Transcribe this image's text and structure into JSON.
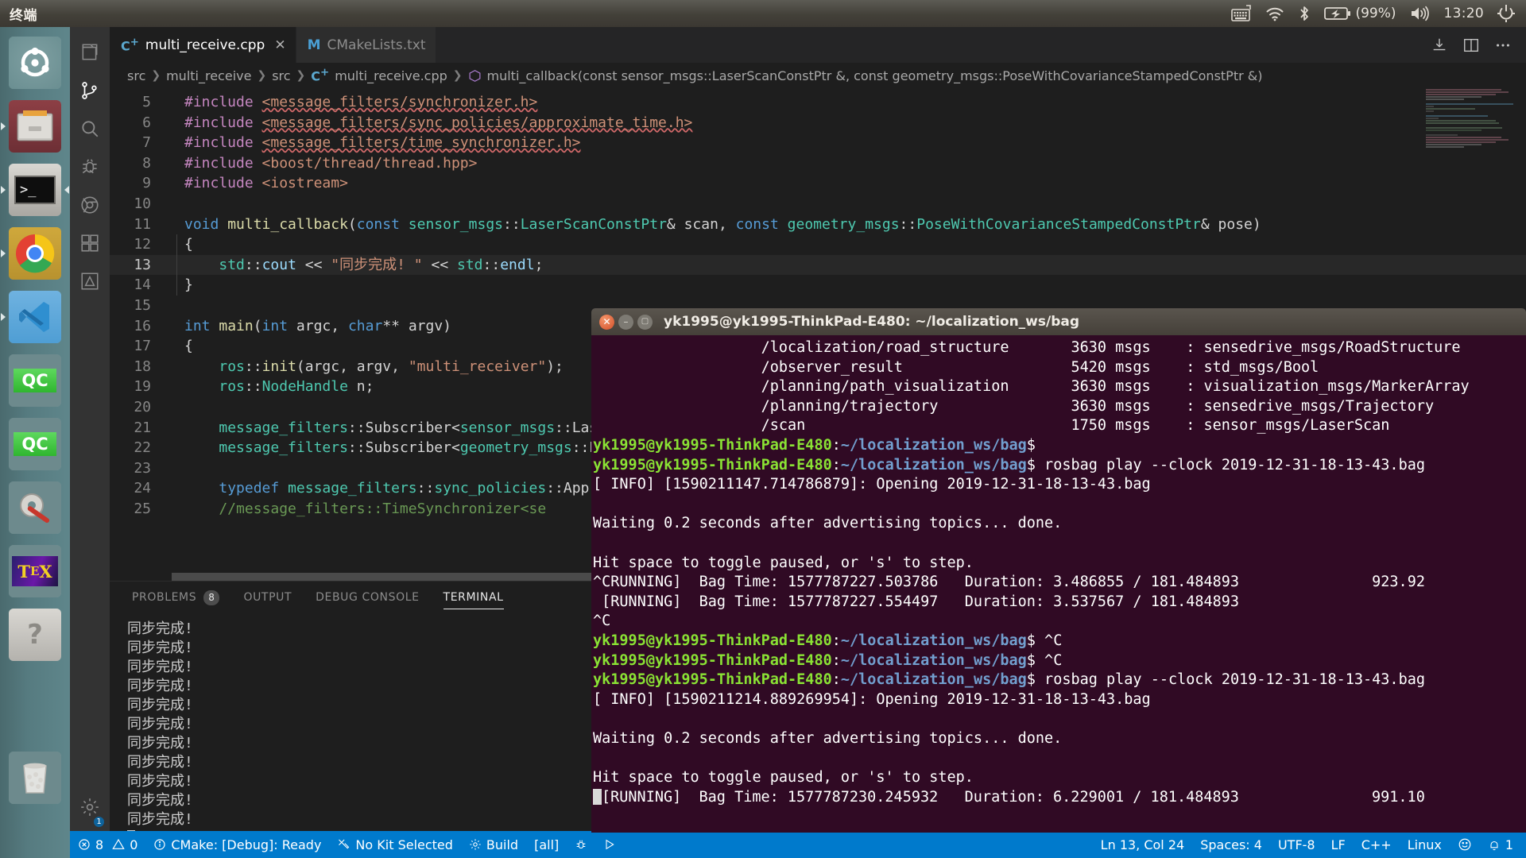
{
  "os_panel": {
    "app_name": "终端",
    "tray": {
      "keyboard_icon": "keyboard-icon",
      "wifi_icon": "wifi-icon",
      "bluetooth_icon": "bluetooth-icon",
      "battery_icon": "battery-charging-icon",
      "battery_label": "(99%)",
      "volume_icon": "volume-icon",
      "clock": "13:20",
      "power_icon": "power-gear-icon"
    }
  },
  "launcher": {
    "items": [
      {
        "name": "ubuntu-dash-icon",
        "label": "Ubuntu Dash",
        "running": false,
        "focused": false
      },
      {
        "name": "files-icon",
        "label": "Files",
        "running": true,
        "focused": false
      },
      {
        "name": "terminal-icon",
        "label": "Terminal",
        "running": true,
        "focused": true
      },
      {
        "name": "chrome-icon",
        "label": "Google Chrome",
        "running": true,
        "focused": false
      },
      {
        "name": "vscode-icon",
        "label": "Visual Studio Code",
        "running": true,
        "focused": false
      },
      {
        "name": "qtcreator-icon-1",
        "label": "QC",
        "running": false,
        "focused": false
      },
      {
        "name": "qtcreator-icon-2",
        "label": "QC",
        "running": false,
        "focused": false
      },
      {
        "name": "settings-icon",
        "label": "System Settings",
        "running": false,
        "focused": false
      },
      {
        "name": "texmaker-icon",
        "label": "TeX",
        "running": false,
        "focused": false
      },
      {
        "name": "help-icon",
        "label": "Help",
        "running": false,
        "focused": false
      },
      {
        "name": "trash-icon",
        "label": "Trash",
        "running": false,
        "focused": false
      }
    ]
  },
  "vscode": {
    "activity_bar": [
      {
        "name": "explorer-icon",
        "active": false
      },
      {
        "name": "source-control-icon",
        "active": true
      },
      {
        "name": "search-icon",
        "active": false
      },
      {
        "name": "debug-icon",
        "active": false
      },
      {
        "name": "chrome-debug-icon",
        "active": false
      },
      {
        "name": "extensions-icon",
        "active": false
      },
      {
        "name": "cmake-icon",
        "active": false
      }
    ],
    "activity_bar_bottom": [
      {
        "name": "settings-gear-icon",
        "badge": "1"
      }
    ],
    "tabs": [
      {
        "label": "multi_receive.cpp",
        "icon": "cpp-file-icon",
        "active": true,
        "closable": true
      },
      {
        "label": "CMakeLists.txt",
        "icon": "cmake-file-icon",
        "active": false,
        "closable": false
      }
    ],
    "tab_actions": [
      {
        "name": "run-build-icon"
      },
      {
        "name": "split-editor-icon"
      },
      {
        "name": "more-actions-icon"
      }
    ],
    "breadcrumb": [
      {
        "label": "src",
        "icon": null
      },
      {
        "label": "multi_receive",
        "icon": null
      },
      {
        "label": "src",
        "icon": null
      },
      {
        "label": "multi_receive.cpp",
        "icon": "cpp-file-icon"
      },
      {
        "label": "multi_callback(const sensor_msgs::LaserScanConstPtr &, const geometry_msgs::PoseWithCovarianceStampedConstPtr &)",
        "icon": "symbol-method-icon"
      }
    ],
    "editor": {
      "lines": [
        {
          "num": "5",
          "tokens": [
            {
              "t": "#include ",
              "c": "k-pre"
            },
            {
              "t": "<message_filters/synchronizer.h>",
              "c": "k-str squiggle"
            }
          ]
        },
        {
          "num": "6",
          "tokens": [
            {
              "t": "#include ",
              "c": "k-pre"
            },
            {
              "t": "<message_filters/sync_policies/approximate_time.h>",
              "c": "k-str squiggle"
            }
          ]
        },
        {
          "num": "7",
          "tokens": [
            {
              "t": "#include ",
              "c": "k-pre"
            },
            {
              "t": "<message_filters/time_synchronizer.h>",
              "c": "k-str squiggle"
            }
          ]
        },
        {
          "num": "8",
          "tokens": [
            {
              "t": "#include ",
              "c": "k-pre"
            },
            {
              "t": "<boost/thread/thread.hpp>",
              "c": "k-str"
            }
          ]
        },
        {
          "num": "9",
          "tokens": [
            {
              "t": "#include ",
              "c": "k-pre"
            },
            {
              "t": "<iostream>",
              "c": "k-str"
            }
          ]
        },
        {
          "num": "10",
          "tokens": []
        },
        {
          "num": "11",
          "tokens": [
            {
              "t": "void ",
              "c": "k-kw"
            },
            {
              "t": "multi_callback",
              "c": "k-fn"
            },
            {
              "t": "(",
              "c": "k-plain"
            },
            {
              "t": "const ",
              "c": "k-kw"
            },
            {
              "t": "sensor_msgs",
              "c": "k-typ"
            },
            {
              "t": "::",
              "c": "k-plain"
            },
            {
              "t": "LaserScanConstPtr",
              "c": "k-typ"
            },
            {
              "t": "& scan, ",
              "c": "k-plain"
            },
            {
              "t": "const ",
              "c": "k-kw"
            },
            {
              "t": "geometry_msgs",
              "c": "k-typ"
            },
            {
              "t": "::",
              "c": "k-plain"
            },
            {
              "t": "PoseWithCovarianceStampedConstPtr",
              "c": "k-typ"
            },
            {
              "t": "& pose)",
              "c": "k-plain"
            }
          ]
        },
        {
          "num": "12",
          "tokens": [
            {
              "t": "{",
              "c": "k-plain"
            }
          ]
        },
        {
          "num": "13",
          "highlight": true,
          "tokens": [
            {
              "t": "    ",
              "c": "k-plain"
            },
            {
              "t": "std",
              "c": "k-typ"
            },
            {
              "t": "::",
              "c": "k-plain"
            },
            {
              "t": "cout",
              "c": "k-var"
            },
            {
              "t": " << ",
              "c": "k-plain"
            },
            {
              "t": "\"同步完成! \"",
              "c": "k-str"
            },
            {
              "t": " << ",
              "c": "k-plain"
            },
            {
              "t": "std",
              "c": "k-typ"
            },
            {
              "t": "::",
              "c": "k-plain"
            },
            {
              "t": "endl",
              "c": "k-var"
            },
            {
              "t": ";",
              "c": "k-plain"
            }
          ]
        },
        {
          "num": "14",
          "tokens": [
            {
              "t": "}",
              "c": "k-plain"
            }
          ]
        },
        {
          "num": "15",
          "tokens": []
        },
        {
          "num": "16",
          "tokens": [
            {
              "t": "int ",
              "c": "k-kw"
            },
            {
              "t": "main",
              "c": "k-fn"
            },
            {
              "t": "(",
              "c": "k-plain"
            },
            {
              "t": "int ",
              "c": "k-kw"
            },
            {
              "t": "argc, ",
              "c": "k-plain"
            },
            {
              "t": "char",
              "c": "k-kw"
            },
            {
              "t": "** argv)",
              "c": "k-plain"
            }
          ]
        },
        {
          "num": "17",
          "tokens": [
            {
              "t": "{",
              "c": "k-plain"
            }
          ]
        },
        {
          "num": "18",
          "tokens": [
            {
              "t": "    ",
              "c": "k-plain"
            },
            {
              "t": "ros",
              "c": "k-typ"
            },
            {
              "t": "::",
              "c": "k-plain"
            },
            {
              "t": "init",
              "c": "k-fn"
            },
            {
              "t": "(argc, argv, ",
              "c": "k-plain"
            },
            {
              "t": "\"multi_receiver\"",
              "c": "k-str"
            },
            {
              "t": ");",
              "c": "k-plain"
            }
          ]
        },
        {
          "num": "19",
          "tokens": [
            {
              "t": "    ",
              "c": "k-plain"
            },
            {
              "t": "ros",
              "c": "k-typ"
            },
            {
              "t": "::",
              "c": "k-plain"
            },
            {
              "t": "NodeHandle",
              "c": "k-typ"
            },
            {
              "t": " n;",
              "c": "k-plain"
            }
          ]
        },
        {
          "num": "20",
          "tokens": []
        },
        {
          "num": "21",
          "tokens": [
            {
              "t": "    ",
              "c": "k-plain"
            },
            {
              "t": "message_filters",
              "c": "k-typ"
            },
            {
              "t": "::",
              "c": "k-plain"
            },
            {
              "t": "Subscriber",
              "c": "k-plain"
            },
            {
              "t": "<",
              "c": "k-plain"
            },
            {
              "t": "sensor_msgs",
              "c": "k-typ"
            },
            {
              "t": "::LaserScan> scan_sub(n, ",
              "c": "k-plain"
            }
          ]
        },
        {
          "num": "22",
          "tokens": [
            {
              "t": "    ",
              "c": "k-plain"
            },
            {
              "t": "message_filters",
              "c": "k-typ"
            },
            {
              "t": "::",
              "c": "k-plain"
            },
            {
              "t": "Subscriber",
              "c": "k-plain"
            },
            {
              "t": "<",
              "c": "k-plain"
            },
            {
              "t": "geometry_msgs",
              "c": "k-typ"
            },
            {
              "t": "::PoseWithCov",
              "c": "k-plain"
            }
          ]
        },
        {
          "num": "23",
          "tokens": []
        },
        {
          "num": "24",
          "tokens": [
            {
              "t": "    ",
              "c": "k-plain"
            },
            {
              "t": "typedef ",
              "c": "k-kw"
            },
            {
              "t": "message_filters",
              "c": "k-typ"
            },
            {
              "t": "::",
              "c": "k-plain"
            },
            {
              "t": "sync_policies",
              "c": "k-typ"
            },
            {
              "t": "::Approxi",
              "c": "k-plain"
            }
          ]
        },
        {
          "num": "25",
          "tokens": [
            {
              "t": "    //message_filters::TimeSynchronizer<se",
              "c": "k-com"
            }
          ]
        }
      ]
    },
    "panel": {
      "tabs": [
        {
          "label": "PROBLEMS",
          "badge": "8",
          "active": false
        },
        {
          "label": "OUTPUT",
          "badge": null,
          "active": false
        },
        {
          "label": "DEBUG CONSOLE",
          "badge": null,
          "active": false
        },
        {
          "label": "TERMINAL",
          "badge": null,
          "active": true
        }
      ],
      "terminal_lines": [
        "同步完成!",
        "同步完成!",
        "同步完成!",
        "同步完成!",
        "同步完成!",
        "同步完成!",
        "同步完成!",
        "同步完成!",
        "同步完成!",
        "同步完成!",
        "同步完成!"
      ]
    },
    "status_bar": {
      "left": [
        {
          "name": "errors-warnings",
          "icon": "error-icon",
          "text": "8",
          "icon2": "warning-icon",
          "text2": "0"
        },
        {
          "name": "cmake-status",
          "icon": "info-icon",
          "text": "CMake: [Debug]: Ready"
        },
        {
          "name": "kit-status",
          "icon": "tools-icon",
          "text": "No Kit Selected"
        },
        {
          "name": "build-button",
          "icon": "gear-icon",
          "text": "Build"
        },
        {
          "name": "build-target",
          "icon": null,
          "text": "[all]"
        },
        {
          "name": "debug-button",
          "icon": "bug-icon",
          "text": ""
        },
        {
          "name": "run-button",
          "icon": "play-icon",
          "text": ""
        }
      ],
      "right": [
        {
          "name": "cursor-position",
          "text": "Ln 13, Col 24"
        },
        {
          "name": "indentation",
          "text": "Spaces: 4"
        },
        {
          "name": "encoding",
          "text": "UTF-8"
        },
        {
          "name": "eol",
          "text": "LF"
        },
        {
          "name": "language-mode",
          "text": "C++"
        },
        {
          "name": "platform",
          "text": "Linux"
        },
        {
          "name": "feedback-smiley",
          "text": "☺"
        },
        {
          "name": "notifications",
          "text": "1"
        }
      ]
    }
  },
  "terminal_window": {
    "title": "yk1995@yk1995-ThinkPad-E480: ~/localization_ws/bag",
    "buttons": [
      "close",
      "minimize",
      "maximize"
    ],
    "lines": [
      {
        "segments": [
          {
            "t": "                   /localization/road_structure       3630 msgs    : sensedrive_msgs/RoadStructure",
            "c": "w"
          }
        ]
      },
      {
        "segments": [
          {
            "t": "                   /observer_result                   5420 msgs    : std_msgs/Bool",
            "c": "w"
          }
        ]
      },
      {
        "segments": [
          {
            "t": "                   /planning/path_visualization       3630 msgs    : visualization_msgs/MarkerArray",
            "c": "w"
          }
        ]
      },
      {
        "segments": [
          {
            "t": "                   /planning/trajectory               3630 msgs    : sensedrive_msgs/Trajectory",
            "c": "w"
          }
        ]
      },
      {
        "segments": [
          {
            "t": "                   /scan                              1750 msgs    : sensor_msgs/LaserScan",
            "c": "w"
          }
        ]
      },
      {
        "segments": [
          {
            "t": "yk1995@yk1995-ThinkPad-E480",
            "c": "g"
          },
          {
            "t": ":",
            "c": "w"
          },
          {
            "t": "~/localization_ws/bag",
            "c": "b"
          },
          {
            "t": "$ ",
            "c": "w"
          }
        ]
      },
      {
        "segments": [
          {
            "t": "yk1995@yk1995-ThinkPad-E480",
            "c": "g"
          },
          {
            "t": ":",
            "c": "w"
          },
          {
            "t": "~/localization_ws/bag",
            "c": "b"
          },
          {
            "t": "$ rosbag play --clock 2019-12-31-18-13-43.bag",
            "c": "w"
          }
        ]
      },
      {
        "segments": [
          {
            "t": "[ INFO] [1590211147.714786879]: Opening 2019-12-31-18-13-43.bag",
            "c": "w"
          }
        ]
      },
      {
        "segments": [
          {
            "t": "",
            "c": "w"
          }
        ]
      },
      {
        "segments": [
          {
            "t": "Waiting 0.2 seconds after advertising topics... done.",
            "c": "w"
          }
        ]
      },
      {
        "segments": [
          {
            "t": "",
            "c": "w"
          }
        ]
      },
      {
        "segments": [
          {
            "t": "Hit space to toggle paused, or 's' to step.",
            "c": "w"
          }
        ]
      },
      {
        "segments": [
          {
            "t": "^CRUNNING]  Bag Time: 1577787227.503786   Duration: 3.486855 / 181.484893               923.92",
            "c": "w"
          }
        ]
      },
      {
        "segments": [
          {
            "t": " [RUNNING]  Bag Time: 1577787227.554497   Duration: 3.537567 / 181.484893",
            "c": "w"
          }
        ]
      },
      {
        "segments": [
          {
            "t": "^C",
            "c": "w"
          }
        ]
      },
      {
        "segments": [
          {
            "t": "yk1995@yk1995-ThinkPad-E480",
            "c": "g"
          },
          {
            "t": ":",
            "c": "w"
          },
          {
            "t": "~/localization_ws/bag",
            "c": "b"
          },
          {
            "t": "$ ^C",
            "c": "w"
          }
        ]
      },
      {
        "segments": [
          {
            "t": "yk1995@yk1995-ThinkPad-E480",
            "c": "g"
          },
          {
            "t": ":",
            "c": "w"
          },
          {
            "t": "~/localization_ws/bag",
            "c": "b"
          },
          {
            "t": "$ ^C",
            "c": "w"
          }
        ]
      },
      {
        "segments": [
          {
            "t": "yk1995@yk1995-ThinkPad-E480",
            "c": "g"
          },
          {
            "t": ":",
            "c": "w"
          },
          {
            "t": "~/localization_ws/bag",
            "c": "b"
          },
          {
            "t": "$ rosbag play --clock 2019-12-31-18-13-43.bag",
            "c": "w"
          }
        ]
      },
      {
        "segments": [
          {
            "t": "[ INFO] [1590211214.889269954]: Opening 2019-12-31-18-13-43.bag",
            "c": "w"
          }
        ]
      },
      {
        "segments": [
          {
            "t": "",
            "c": "w"
          }
        ]
      },
      {
        "segments": [
          {
            "t": "Waiting 0.2 seconds after advertising topics... done.",
            "c": "w"
          }
        ]
      },
      {
        "segments": [
          {
            "t": "",
            "c": "w"
          }
        ]
      },
      {
        "segments": [
          {
            "t": "Hit space to toggle paused, or 's' to step.",
            "c": "w"
          }
        ]
      },
      {
        "segments": [
          {
            "t": "cursor",
            "c": "cur"
          },
          {
            "t": "[RUNNING]  Bag Time: 1577787230.245932   Duration: 6.229001 / 181.484893               991.10",
            "c": "w"
          }
        ]
      }
    ]
  },
  "colors": {
    "accent_blue": "#007acc",
    "terminal_bg": "#300a24",
    "terminal_green": "#8ae234",
    "terminal_blue": "#729fcf",
    "vscode_bg": "#1e1e1e",
    "panel_bg": "#252526",
    "launcher_bg": "#567b80"
  }
}
